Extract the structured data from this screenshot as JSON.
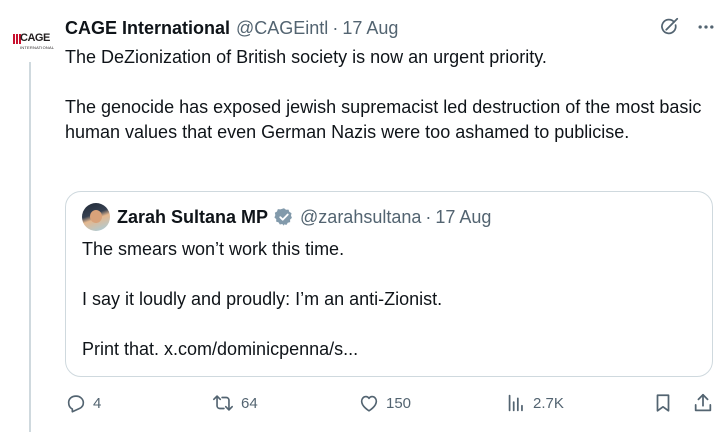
{
  "tweet": {
    "author_name": "CAGE International",
    "author_handle": "@CAGEintl",
    "separator": "·",
    "date": "17 Aug",
    "logo_text": "CAGE",
    "logo_subtext": "INTERNATIONAL",
    "paragraphs": [
      "The DeZionization of British society is now an urgent priority.",
      "The genocide has exposed jewish supremacist led destruction of the most basic human values that even German Nazis were too ashamed to publicise."
    ]
  },
  "quote": {
    "author_name": "Zarah Sultana MP",
    "author_handle": "@zarahsultana",
    "separator": "·",
    "date": "17 Aug",
    "paragraphs": [
      "The smears won’t work this time.",
      "I say it loudly and proudly: I’m an anti-Zionist.",
      "Print that. x.com/dominicpenna/s..."
    ]
  },
  "actions": {
    "replies": "4",
    "reposts": "64",
    "likes": "150",
    "views": "2.7K"
  },
  "icons": {
    "top": [
      "grok-icon",
      "more-icon"
    ],
    "actions": [
      "reply-icon",
      "repost-icon",
      "like-icon",
      "views-icon",
      "bookmark-icon",
      "share-icon"
    ],
    "verified": "verified-badge-icon"
  },
  "colors": {
    "text": "#0f1419",
    "muted": "#536471",
    "border": "#cfd9de",
    "brand_red": "#c8102e",
    "verified_gray": "#829aab"
  }
}
